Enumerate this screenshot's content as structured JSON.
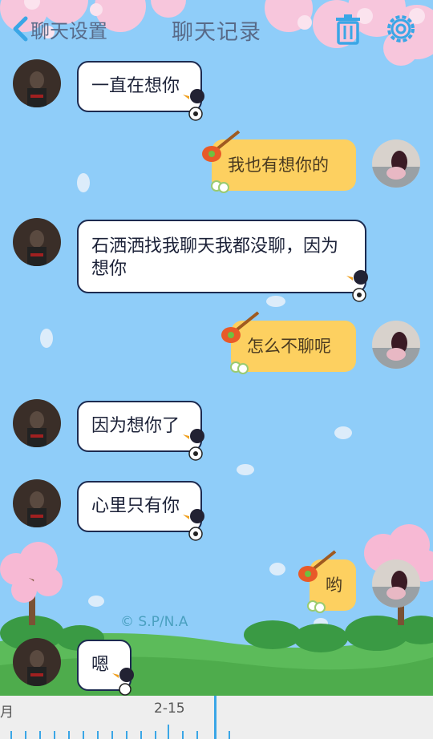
{
  "header": {
    "back_label": "聊天设置",
    "title": "聊天记录"
  },
  "icons": {
    "back": "chevron-left-icon",
    "trash": "trash-icon",
    "settings": "gear-icon"
  },
  "colors": {
    "sky": "#8fcdf9",
    "header_icon": "#3aa6e6",
    "bubble_received": "#ffffff",
    "bubble_sent": "#fdd060",
    "bubble_border": "#1c2a50"
  },
  "messages": [
    {
      "side": "received",
      "text": "一直在想你"
    },
    {
      "side": "sent",
      "text": "我也有想你的"
    },
    {
      "side": "received",
      "text": "石洒洒找我聊天我都没聊，因为想你"
    },
    {
      "side": "sent",
      "text": "怎么不聊呢"
    },
    {
      "side": "received",
      "text": "因为想你了"
    },
    {
      "side": "received",
      "text": "心里只有你"
    },
    {
      "side": "sent",
      "text": "哟"
    },
    {
      "side": "received",
      "text": "嗯"
    }
  ],
  "watermark": "© S.P/N.A",
  "timeline": {
    "month_label": "月",
    "date_label": "2-15"
  }
}
